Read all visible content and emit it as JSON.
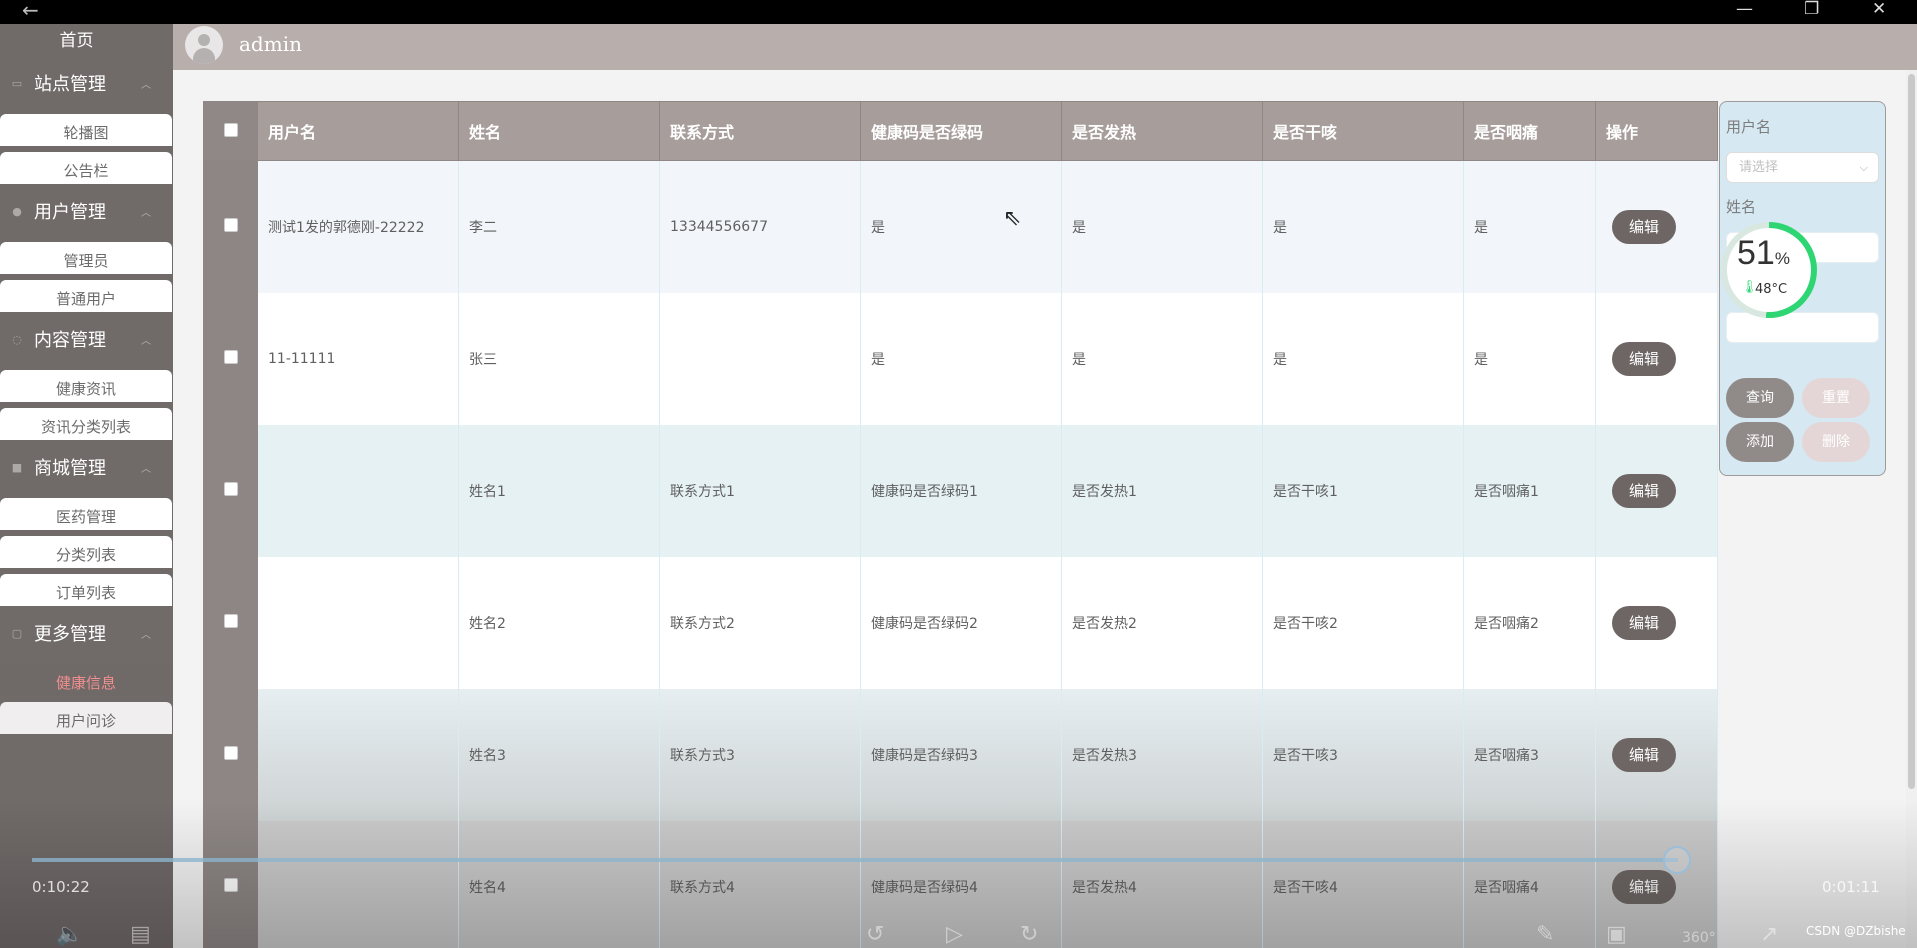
{
  "topbar": {
    "back_icon": "←",
    "minimize": "—",
    "maximize": "❐",
    "close": "✕"
  },
  "header": {
    "username": "admin"
  },
  "sidebar": {
    "home": "首页",
    "groups": [
      {
        "title": "站点管理",
        "items": [
          "轮播图",
          "公告栏"
        ]
      },
      {
        "title": "用户管理",
        "items": [
          "管理员",
          "普通用户"
        ]
      },
      {
        "title": "内容管理",
        "items": [
          "健康资讯",
          "资讯分类列表"
        ]
      },
      {
        "title": "商城管理",
        "items": [
          "医药管理",
          "分类列表",
          "订单列表"
        ]
      },
      {
        "title": "更多管理",
        "items": [
          "健康信息",
          "用户问诊"
        ]
      }
    ],
    "active_item": "健康信息"
  },
  "table": {
    "headers": [
      "用户名",
      "姓名",
      "联系方式",
      "健康码是否绿码",
      "是否发热",
      "是否干咳",
      "是否咽痛",
      "操作"
    ],
    "rows": [
      [
        "测试1发的郭德刚-22222",
        "李二",
        "13344556677",
        "是",
        "是",
        "是",
        "是",
        "编辑"
      ],
      [
        "11-11111",
        "张三",
        "",
        "是",
        "是",
        "是",
        "是",
        "编辑"
      ],
      [
        "",
        "姓名1",
        "联系方式1",
        "健康码是否绿码1",
        "是否发热1",
        "是否干咳1",
        "是否咽痛1",
        "编辑"
      ],
      [
        "",
        "姓名2",
        "联系方式2",
        "健康码是否绿码2",
        "是否发热2",
        "是否干咳2",
        "是否咽痛2",
        "编辑"
      ],
      [
        "",
        "姓名3",
        "联系方式3",
        "健康码是否绿码3",
        "是否发热3",
        "是否干咳3",
        "是否咽痛3",
        "编辑"
      ],
      [
        "",
        "姓名4",
        "联系方式4",
        "健康码是否绿码4",
        "是否发热4",
        "是否干咳4",
        "是否咽痛4",
        "编辑"
      ]
    ]
  },
  "search": {
    "username_label": "用户名",
    "username_placeholder": "请选择",
    "name_label": "姓名",
    "query": "查询",
    "reset": "重置",
    "add": "添加",
    "delete": "删除"
  },
  "widget": {
    "percent": "51",
    "percent_sign": "%",
    "temp": "48°C",
    "level": 0.51
  },
  "video": {
    "current_time": "0:10:22",
    "total_time": "0:01:11",
    "progress": 0.99,
    "speed": "360°"
  },
  "watermark": "CSDN @DZbishe",
  "colors": {
    "sidebar": "#706a69",
    "header": "#b8afad",
    "table_header": "#a79e9c",
    "active_item": "#f08f8f",
    "gauge": "#2ed573"
  }
}
